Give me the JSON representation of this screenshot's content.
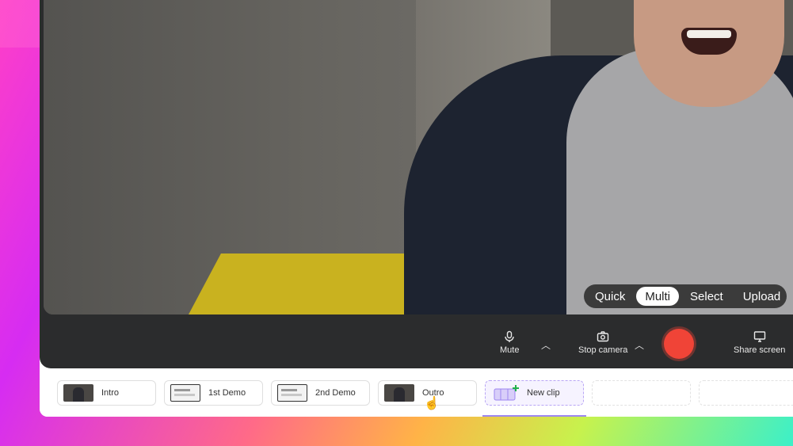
{
  "capture_modes": [
    {
      "label": "Quick",
      "active": false
    },
    {
      "label": "Multi",
      "active": true
    },
    {
      "label": "Select",
      "active": false
    },
    {
      "label": "Upload",
      "active": false
    }
  ],
  "toolbar": {
    "mute_label": "Mute",
    "stop_camera_label": "Stop camera",
    "share_screen_label": "Share screen",
    "record_color": "#f04437"
  },
  "clips": [
    {
      "label": "Intro",
      "thumb": "camera"
    },
    {
      "label": "1st Demo",
      "thumb": "screen"
    },
    {
      "label": "2nd Demo",
      "thumb": "screen"
    },
    {
      "label": "Outro",
      "thumb": "camera"
    }
  ],
  "new_clip_label": "New clip",
  "colors": {
    "accent": "#9d87f0",
    "record": "#f04437",
    "panel": "#2b2c2d"
  }
}
